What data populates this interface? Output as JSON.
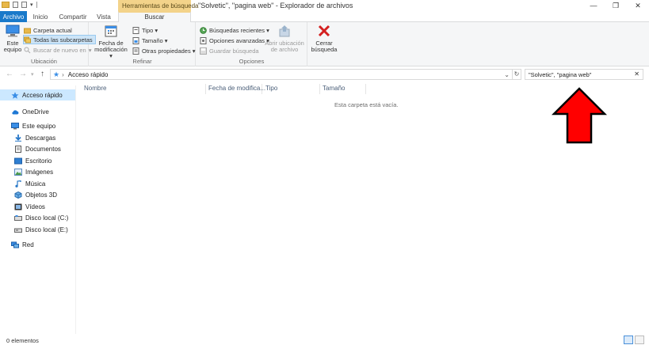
{
  "window": {
    "title": "\"Solvetic\", \"pagina web\" - Explorador de archivos",
    "context_header": "Herramientas de búsqueda",
    "minimize": "—",
    "maximize": "❐",
    "close": "✕"
  },
  "ribbon_tabs": {
    "archivo": "Archivo",
    "inicio": "Inicio",
    "compartir": "Compartir",
    "vista": "Vista",
    "buscar": "Buscar"
  },
  "ribbon": {
    "ubicacion": {
      "label": "Ubicación",
      "este_equipo": [
        "Este",
        "equipo"
      ],
      "carpeta_actual": "Carpeta actual",
      "todas_subcarpetas": "Todas las subcarpetas",
      "buscar_de_nuevo": "Buscar de nuevo en"
    },
    "refinar": {
      "label": "Refinar",
      "fecha": [
        "Fecha de",
        "modificación ▾"
      ],
      "tipo": "Tipo ▾",
      "tamano": "Tamaño ▾",
      "otras": "Otras propiedades ▾"
    },
    "opciones": {
      "label": "Opciones",
      "recientes": "Búsquedas recientes ▾",
      "avanzadas": "Opciones avanzadas ▾",
      "guardar": "Guardar búsqueda",
      "abrir": [
        "Abrir ubicación",
        "de archivo"
      ]
    },
    "cerrar": {
      "label": [
        "Cerrar",
        "búsqueda"
      ]
    }
  },
  "address": {
    "path": "Acceso rápido",
    "search_value": "\"Solvetic\", \"pagina web\""
  },
  "nav": {
    "items": [
      "Acceso rápido",
      "OneDrive",
      "Este equipo",
      "Descargas",
      "Documentos",
      "Escritorio",
      "Imágenes",
      "Música",
      "Objetos 3D",
      "Vídeos",
      "Disco local (C:)",
      "Disco local (E:)",
      "Red"
    ]
  },
  "columns": {
    "nombre": "Nombre",
    "fecha": "Fecha de modifica...",
    "tipo": "Tipo",
    "tamano": "Tamaño"
  },
  "content": {
    "empty_message": "Esta carpeta está vacía."
  },
  "status": {
    "items_count": "0 elementos"
  },
  "colors": {
    "accent": "#1979ca",
    "context": "#f3d38a",
    "selected_nav": "#cce8ff",
    "arrow": "#ff0000"
  }
}
